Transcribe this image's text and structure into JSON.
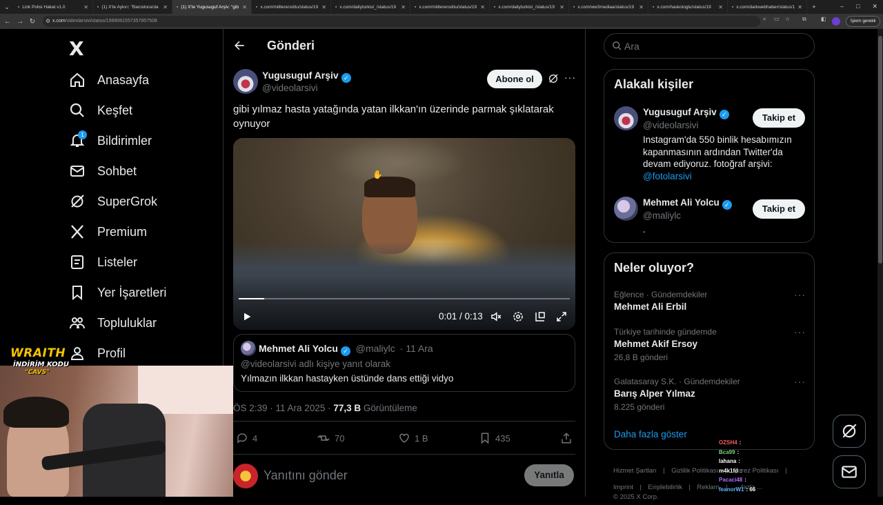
{
  "browser": {
    "tabs": [
      {
        "title": "Link Polisi Hakat v1.0",
        "active": false
      },
      {
        "title": "(1) X'te Aykırı: \"Barcelona'da",
        "active": false
      },
      {
        "title": "(1) X'te Yugusuguf Arşiv: \"gib",
        "active": true
      },
      {
        "title": "x.com/militerenstitu/status/19",
        "active": false
      },
      {
        "title": "x.com/dailyturkist_/status/19",
        "active": false
      },
      {
        "title": "x.com/militerenstitu/status/19",
        "active": false
      },
      {
        "title": "x.com/dailyturkist_/status/19",
        "active": false
      },
      {
        "title": "x.com/ww3mediaa/status/19",
        "active": false
      },
      {
        "title": "x.com/haskologlu/status/19",
        "active": false
      },
      {
        "title": "x.com/darkwebhaber/status/19",
        "active": false
      }
    ],
    "url_domain": "x.com",
    "url_path": "/videolarsivi/status/1999081557357957508",
    "action_button": "İşlem gerekli"
  },
  "sidebar": {
    "logo": "X",
    "items": [
      {
        "label": "Anasayfa",
        "icon": "home-icon"
      },
      {
        "label": "Keşfet",
        "icon": "search-icon"
      },
      {
        "label": "Bildirimler",
        "icon": "bell-icon",
        "badge": "1"
      },
      {
        "label": "Sohbet",
        "icon": "mail-icon"
      },
      {
        "label": "SuperGrok",
        "icon": "grok-icon"
      },
      {
        "label": "Premium",
        "icon": "x-icon"
      },
      {
        "label": "Listeler",
        "icon": "list-icon"
      },
      {
        "label": "Yer İşaretleri",
        "icon": "bookmark-icon"
      },
      {
        "label": "Topluluklar",
        "icon": "communities-icon"
      },
      {
        "label": "Profil",
        "icon": "profile-icon"
      }
    ]
  },
  "overlay": {
    "brand": "WRAITH",
    "promo": "İNDİRİM KODU",
    "code": "\"CAVS\""
  },
  "post": {
    "header_title": "Gönderi",
    "author_name": "Yugusuguf Arşiv",
    "author_handle": "@videolarsivi",
    "subscribe_label": "Abone ol",
    "text": "gibi yılmaz hasta yatağında yatan ilkkan'ın üzerinde parmak şıklatarak oynuyor",
    "video_time": "0:01 / 0:13",
    "video_progress": 0.077,
    "quote": {
      "name": "Mehmet Ali Yolcu",
      "handle": "@maliylc",
      "date": "· 11 Ara",
      "reply_to": "@videolarsivi adlı kişiye yanıt olarak",
      "text": "Yılmazın ilkkan hastayken üstünde dans ettiği vidyo"
    },
    "timestamp": "ÖS 2:39 · 11 Ara 2025 · ",
    "views_count": "77,3 B",
    "views_label": "Görüntüleme",
    "actions": {
      "replies": "4",
      "reposts": "70",
      "likes": "1 B",
      "bookmarks": "435"
    },
    "reply_placeholder": "Yanıtını gönder",
    "reply_button": "Yanıtla"
  },
  "right": {
    "search_placeholder": "Ara",
    "related_title": "Alakalı kişiler",
    "related": [
      {
        "name": "Yugusuguf Arşiv",
        "handle": "@videolarsivi",
        "button": "Takip et",
        "bio": "Instagram'da 550 binlik hesabımızın kapanmasının ardından Twitter'da devam ediyoruz. fotoğraf arşivi:",
        "bio_link": "@fotolarsivi"
      },
      {
        "name": "Mehmet Ali Yolcu",
        "handle": "@maliylc",
        "button": "Takip et",
        "bio": "."
      }
    ],
    "trends_title": "Neler oluyor?",
    "trends": [
      {
        "meta": "Eğlence · Gündemdekiler",
        "name": "Mehmet Ali Erbil",
        "count": ""
      },
      {
        "meta": "Türkiye tarihinde gündemde",
        "name": "Mehmet Akif Ersoy",
        "count": "26,8 B gönderi"
      },
      {
        "meta": "Galatasaray S.K. · Gündemdekiler",
        "name": "Barış Alper Yılmaz",
        "count": "8.225 gönderi"
      }
    ],
    "show_more": "Daha fazla göster",
    "footer": {
      "line1": [
        "Hizmet Şartları",
        "Gizlilik Politikası",
        "Çerez Politikası"
      ],
      "line2": [
        "Imprint",
        "Erişilebilirlik",
        "Reklam",
        "... fazla ..."
      ],
      "copyright": "© 2025 X Corp."
    }
  },
  "chat": [
    {
      "user": "OZSH4",
      "msg": ":",
      "color": "#ff5a5a"
    },
    {
      "user": "Bca99",
      "msg": ":",
      "color": "#7cd67c"
    },
    {
      "user": "lahana",
      "msg": ":",
      "color": "#ffffff"
    },
    {
      "user": "m4k1fd",
      "msg": ":",
      "color": "#ffffff"
    },
    {
      "user": "Pacaci48",
      "msg": ":",
      "color": "#b06cff"
    },
    {
      "user": "feanorW1",
      "msg": ": 66",
      "color": "#5fb4ff"
    }
  ]
}
